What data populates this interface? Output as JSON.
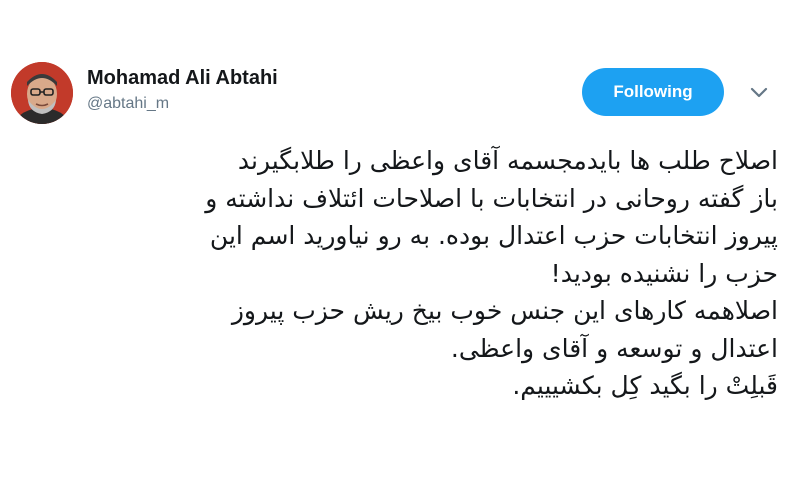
{
  "author": {
    "display_name": "Mohamad Ali Abtahi",
    "handle": "@abtahi_m"
  },
  "actions": {
    "follow_label": "Following"
  },
  "icons": {
    "menu": "chevron-down-icon"
  },
  "colors": {
    "accent": "#1da1f2",
    "avatar_background": "#c23a2a",
    "text": "#14171a",
    "handle": "#657786"
  },
  "tweet": {
    "lines": [
      "اصلاح طلب ها بایدمجسمه آقای واعظی را طلابگیرند",
      "باز گفته روحانی در انتخابات با اصلاحات ائتلاف نداشته و",
      "پیروز انتخابات حزب اعتدال بوده. به رو نیاورید اسم این",
      "حزب را نشنیده بودید!",
      "اصلاهمه کارهای این جنس خوب بیخ ریش حزب پیروز",
      "اعتدال و توسعه و آقای واعظی.",
      "قَبلِتْ را بگید کِل بکشیییم."
    ]
  }
}
